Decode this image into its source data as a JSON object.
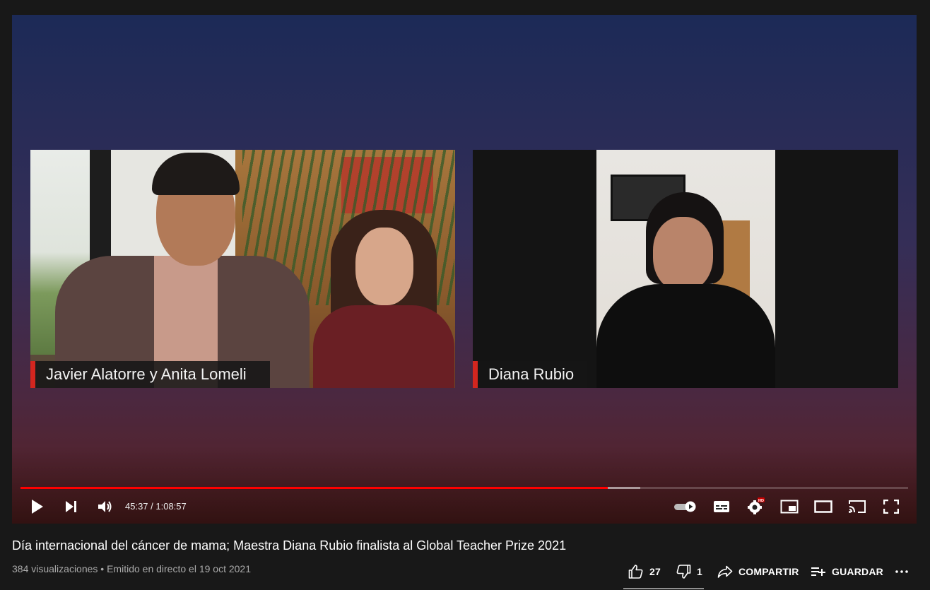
{
  "video": {
    "overlay_left_name": "Javier Alatorre y Anita Lomeli",
    "overlay_right_name": "Diana Rubio",
    "accent_color": "#d3261f"
  },
  "player": {
    "time_display": "45:37 / 1:08:57",
    "current_time": "45:37",
    "duration": "1:08:57",
    "progress_played_fraction": 0.662,
    "progress_buffered_fraction": 0.698,
    "progress_color": "#ff0000",
    "icons": {
      "play": "play-icon",
      "next": "next-icon",
      "volume": "volume-icon",
      "autoplay": "autoplay-toggle-icon",
      "subtitles": "subtitles-icon",
      "settings": "settings-icon",
      "settings_badge": "HD",
      "miniplayer": "miniplayer-icon",
      "theater": "theater-mode-icon",
      "cast": "cast-icon",
      "fullscreen": "fullscreen-icon"
    }
  },
  "info": {
    "title": "Día internacional del cáncer de mama; Maestra Diana Rubio finalista al Global Teacher Prize 2021",
    "views": "384 visualizaciones",
    "separator": "•",
    "date": "Emitido en directo el 19 oct 2021"
  },
  "actions": {
    "likes": "27",
    "dislikes": "1",
    "share": "COMPARTIR",
    "save": "GUARDAR",
    "more": "..."
  }
}
